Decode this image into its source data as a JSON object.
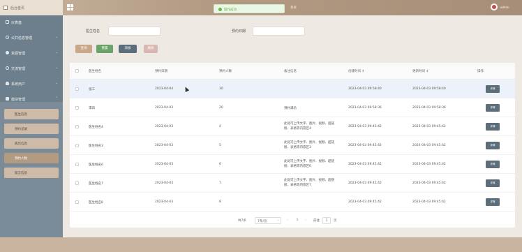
{
  "header": {
    "logo_text": "后台首页",
    "toast_message": "操作成功",
    "ghost_title": "系统",
    "username": "admin"
  },
  "sidebar": {
    "items": [
      {
        "icon": "dashboard-icon",
        "label": "仪表盘"
      },
      {
        "icon": "info-icon",
        "label": "公共信息管理"
      },
      {
        "icon": "pin-icon",
        "label": "资源管理"
      },
      {
        "icon": "chat-icon",
        "label": "交流管理"
      },
      {
        "icon": "user-icon",
        "label": "系统用户"
      },
      {
        "icon": "grid-icon",
        "label": "模块管理"
      }
    ],
    "submenu": [
      {
        "label": "医生信息",
        "active": false
      },
      {
        "label": "预约记录",
        "active": false
      },
      {
        "label": "病历信息",
        "active": false
      },
      {
        "label": "预约人数",
        "active": true
      },
      {
        "label": "留言信息",
        "active": false
      }
    ]
  },
  "search": {
    "doctor_name_label": "医生姓名",
    "doctor_name_value": "",
    "appointment_date_label": "预约日期",
    "appointment_date_value": ""
  },
  "toolbar": {
    "query_label": "查询",
    "reset_label": "重置",
    "add_label": "添加",
    "delete_label": "删除"
  },
  "table": {
    "columns": [
      "医生姓名",
      "预约日期",
      "预约人数",
      "备注信息",
      "创建时间 ⇕",
      "更新时间 ⇕",
      "操作"
    ],
    "detail_label": "详情",
    "rows": [
      {
        "name": "张三",
        "date": "2023-04-04",
        "count": "30",
        "remark": "",
        "created": "2023-04-03 09:58:40",
        "updated": "2023-04-03 09:58:40",
        "highlight": true
      },
      {
        "name": "李四",
        "date": "2023-04-03",
        "count": "20",
        "remark": "预约满员",
        "created": "2023-04-03 09:58:36",
        "updated": "2023-04-03 09:58:36",
        "highlight": false
      },
      {
        "name": "医生姓名4",
        "date": "2023-04-03",
        "count": "4",
        "remark": "此处可上传文字、图片、视频、超链接、表格等内容区4",
        "created": "2023-04-03 09:45:42",
        "updated": "2023-04-03 09:45:42",
        "highlight": false
      },
      {
        "name": "医生姓名3",
        "date": "2023-04-03",
        "count": "5",
        "remark": "此处可上传文字、图片、视频、超链接、表格等内容区3",
        "created": "2023-04-03 09:45:42",
        "updated": "2023-04-03 09:45:42",
        "highlight": false
      },
      {
        "name": "医生姓名6",
        "date": "2023-04-03",
        "count": "6",
        "remark": "此处可上传文字、图片、视频、超链接、表格等内容区6",
        "created": "2023-04-03 09:45:42",
        "updated": "2023-04-03 09:45:42",
        "highlight": false
      },
      {
        "name": "医生姓名7",
        "date": "2023-04-03",
        "count": "7",
        "remark": "此处可上传文字、图片、视频、超链接、表格等内容区7",
        "created": "2023-04-03 09:45:42",
        "updated": "2023-04-03 09:45:42",
        "highlight": false
      },
      {
        "name": "医生姓名8",
        "date": "2023-04-03",
        "count": "8",
        "remark": "",
        "created": "2023-04-03 09:45:42",
        "updated": "2023-04-03 09:45:42",
        "highlight": false
      }
    ]
  },
  "pagination": {
    "total_text": "共7条",
    "page_size_text": "7条/页",
    "prev": "‹",
    "current_page": "1",
    "next": "›",
    "goto_label": "前往",
    "goto_value": "1",
    "goto_suffix": "页"
  },
  "colors": {
    "accent": "#b29a83",
    "sidebar": "#6d7f8c",
    "button_query": "#c9a88a",
    "button_reset": "#6ca36a",
    "button_add": "#5d6e7b",
    "button_delete": "#d9b7b3",
    "success": "#6ab34a"
  }
}
